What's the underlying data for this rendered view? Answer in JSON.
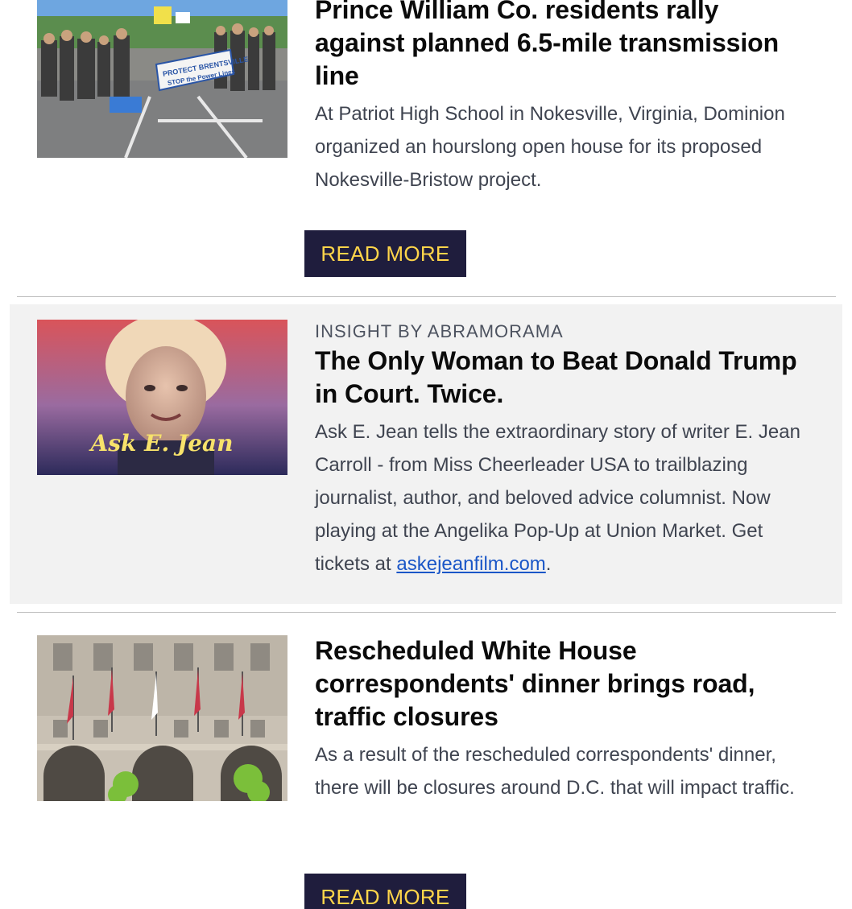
{
  "stories": [
    {
      "headline": "Prince William Co. residents rally against planned 6.5-mile transmission line",
      "dek": "At Patriot High School in Nokesville, Virginia, Dominion organized an hourslong open house for its proposed Nokesville-Bristow project.",
      "read_more_label": "READ MORE",
      "image_sign_text": "PROTECT BRENTSVILLE STOP the Power Lines"
    },
    {
      "kicker": "INSIGHT BY ABRAMORAMA",
      "headline": "The Only Woman to Beat Donald Trump in Court. Twice.",
      "dek_before_link": "Ask E. Jean tells the extraordinary story of writer E. Jean Carroll - from Miss Cheerleader USA to trailblazing journalist, author, and beloved advice columnist. Now playing at the Angelika Pop-Up at Union Market. Get tickets at ",
      "dek_link": "askejeanfilm.com",
      "dek_after_link": ".",
      "image_title": "Ask E. Jean"
    },
    {
      "headline": "Rescheduled White House correspondents' dinner brings road, traffic closures",
      "dek": "As a result of the rescheduled correspondents' dinner, there will be closures around D.C. that will impact traffic.",
      "read_more_label": "READ MORE"
    }
  ],
  "colors": {
    "button_bg": "#1f1d3d",
    "button_text": "#ffd54a",
    "link": "#1a56c7",
    "sponsored_bg": "#f2f2f2"
  }
}
